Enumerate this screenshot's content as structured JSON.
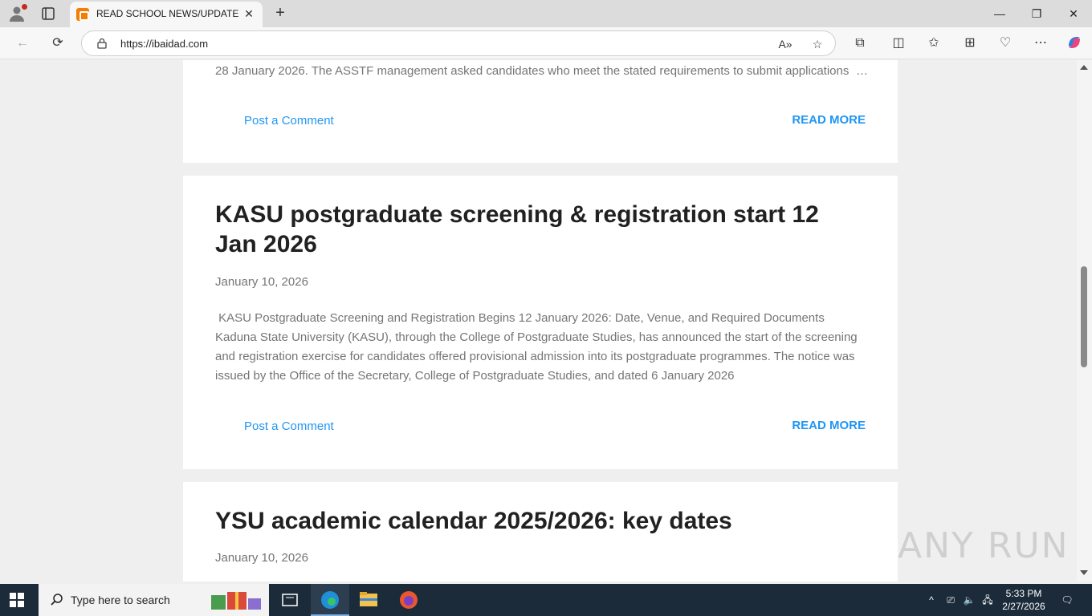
{
  "browser": {
    "tab_title": "READ SCHOOL NEWS/UPDATE",
    "url": "https://ibaidad.com"
  },
  "posts": [
    {
      "snippet": "28 January 2026. The ASSTF management asked candidates who meet the stated requirements to submit applications",
      "ellipsis": "…",
      "comment_label": "Post a Comment",
      "read_more_label": "READ MORE"
    },
    {
      "title": "KASU postgraduate screening & registration start 12 Jan 2026",
      "date": "January 10, 2026",
      "snippet": " KASU Postgraduate Screening and Registration Begins 12 January 2026: Date, Venue, and Required Documents Kaduna State University (KASU), through the College of Postgraduate Studies, has announced the start of the screening and registration exercise for candidates offered provisional admission into its postgraduate programmes. The notice was issued by the Office of the Secretary, College of Postgraduate Studies, and dated 6 January 2026",
      "comment_label": "Post a Comment",
      "read_more_label": "READ MORE"
    },
    {
      "title": "YSU academic calendar 2025/2026: key dates",
      "date": "January 10, 2026"
    }
  ],
  "watermark": "ANY RUN",
  "taskbar": {
    "search_placeholder": "Type here to search",
    "time": "5:33 PM",
    "date": "2/27/2026"
  },
  "colors": {
    "link": "#2196f3",
    "title": "#212121",
    "muted": "#757575",
    "taskbar": "#1c2b3a"
  }
}
